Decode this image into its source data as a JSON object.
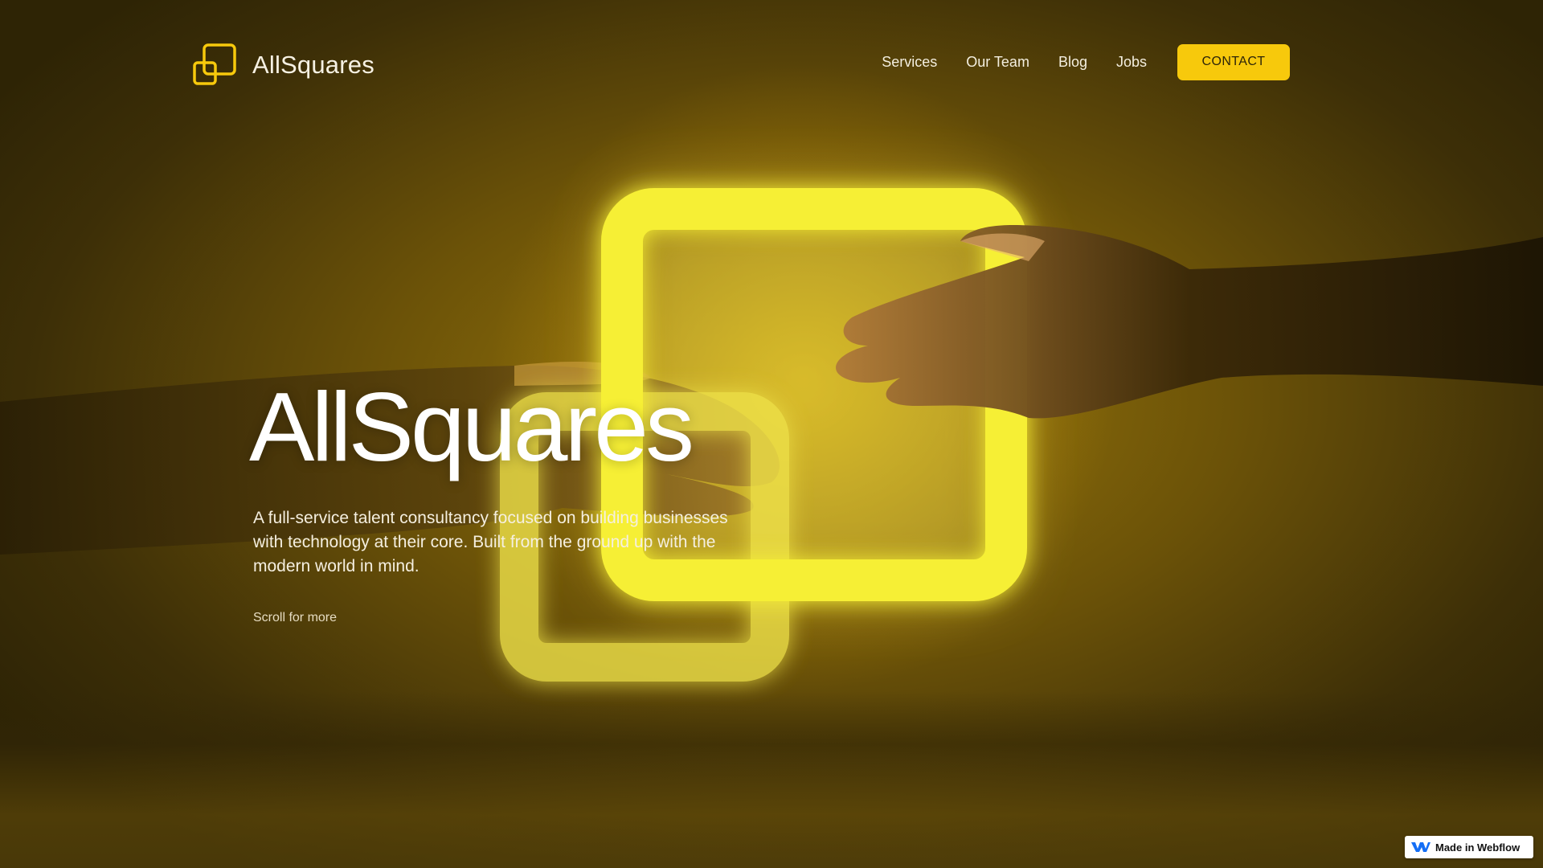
{
  "colors": {
    "accent": "#F7C90C",
    "accent_text": "#2C2409",
    "hero_text": "#FFFFFF",
    "background": "#6B5208"
  },
  "header": {
    "brand_name": "AllSquares",
    "logo_icon": "two-overlapping-squares-icon",
    "nav": {
      "services": "Services",
      "team": "Our Team",
      "blog": "Blog",
      "jobs": "Jobs"
    },
    "contact_label": "CONTACT"
  },
  "hero": {
    "title": "AllSquares",
    "description": "A full-service talent consultancy focused on building businesses with technology at their core. Built from the ground up with the modern world in mind.",
    "scroll_label": "Scroll for more",
    "illustration": "glowing-overlapping-squares-with-reaching-hands"
  },
  "badge": {
    "icon": "webflow-logo-icon",
    "label": "Made in Webflow"
  }
}
